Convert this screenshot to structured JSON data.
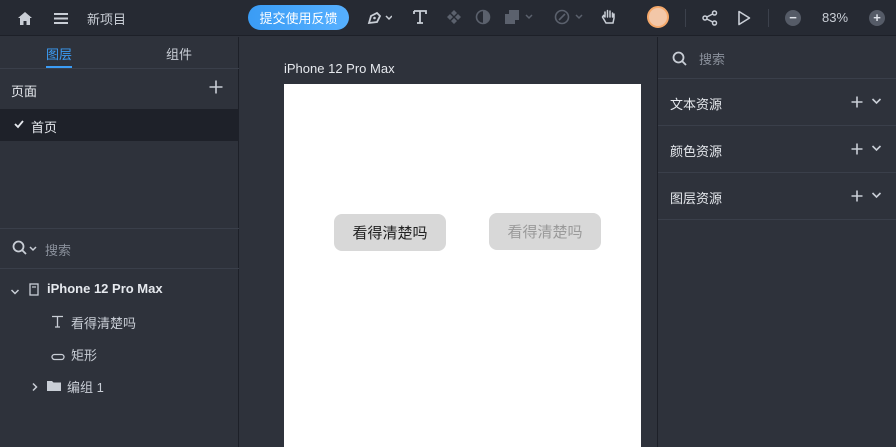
{
  "header": {
    "project_title": "新项目",
    "feedback_label": "提交使用反馈",
    "zoom": "83%"
  },
  "left": {
    "tabs": [
      {
        "label": "图层",
        "active": true
      },
      {
        "label": "组件",
        "active": false
      }
    ],
    "pages_label": "页面",
    "pages": [
      {
        "label": "首页",
        "selected": true
      }
    ],
    "search_placeholder": "搜索",
    "layers": [
      {
        "label": "iPhone 12 Pro Max",
        "icon": "artboard-icon",
        "expanded": true
      },
      {
        "label": "看得清楚吗",
        "icon": "text-icon"
      },
      {
        "label": "矩形",
        "icon": "rectangle-icon"
      },
      {
        "label": "编组 1",
        "icon": "folder-icon",
        "expanded": false
      }
    ]
  },
  "canvas": {
    "artboard_title": "iPhone 12 Pro Max",
    "button_a": "看得清楚吗",
    "button_b": "看得清楚吗"
  },
  "right": {
    "search_placeholder": "搜索",
    "resources": [
      {
        "label": "文本资源"
      },
      {
        "label": "颜色资源"
      },
      {
        "label": "图层资源"
      }
    ]
  },
  "colors": {
    "accent": "#3b9cf5",
    "panel_bg": "#2e323b",
    "topbar_bg": "#262a33",
    "selected_row_bg": "#1e2129"
  }
}
